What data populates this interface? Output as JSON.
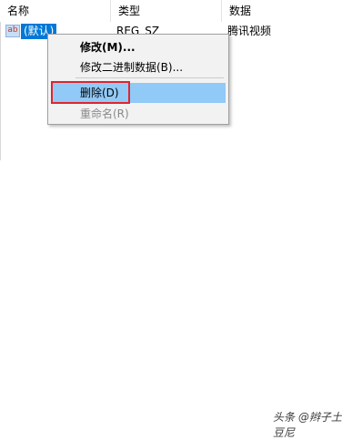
{
  "columns": {
    "name": "名称",
    "type": "类型",
    "data": "数据"
  },
  "row": {
    "icon": "string-value-icon",
    "icon_text": "ab",
    "name": "(默认)",
    "type": "REG_SZ",
    "data": "腾讯视频"
  },
  "context_menu": {
    "items": [
      {
        "label": "修改(M)...",
        "style": "bold"
      },
      {
        "label": "修改二进制数据(B)...",
        "style": "normal"
      },
      {
        "label": "删除(D)",
        "style": "highlighted"
      },
      {
        "label": "重命名(R)",
        "style": "disabled"
      }
    ]
  },
  "annotation": {
    "color": "#e0242e"
  },
  "watermark": "头条 @辫子土豆尼",
  "colors": {
    "selection": "#0078d7",
    "menu_highlight": "#91c9f7",
    "menu_bg": "#f2f2f2"
  }
}
